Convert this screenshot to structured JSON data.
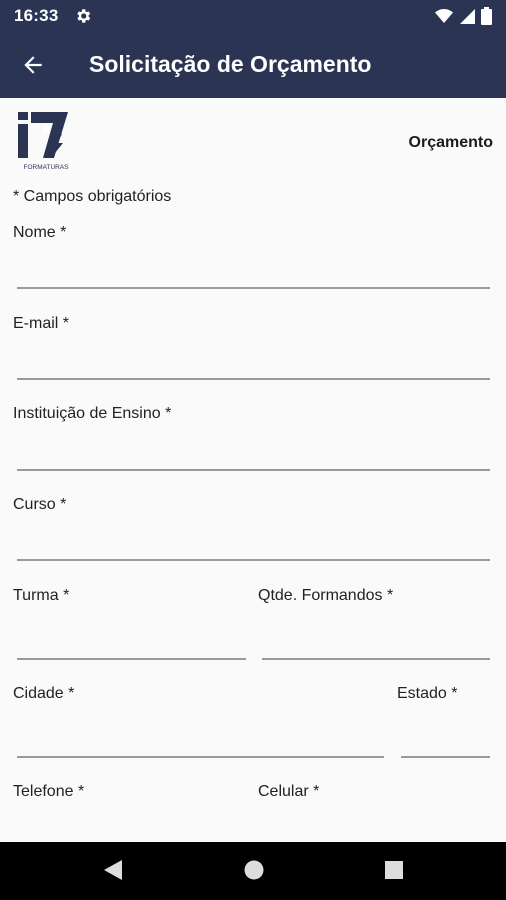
{
  "status": {
    "time": "16:33"
  },
  "appbar": {
    "title": "Solicitação de Orçamento"
  },
  "header": {
    "logo_text": "FORMATURAS",
    "tag": "Orçamento"
  },
  "form": {
    "required_note": "* Campos obrigatórios",
    "fields": {
      "nome": "Nome *",
      "email": "E-mail *",
      "instituicao": "Instituição de Ensino *",
      "curso": "Curso *",
      "turma": "Turma *",
      "qtde": "Qtde. Formandos *",
      "cidade": "Cidade *",
      "estado": "Estado *",
      "telefone": "Telefone *",
      "celular": "Celular *"
    }
  },
  "colors": {
    "bar": "#2b3452",
    "underline": "#9a9a9a"
  }
}
